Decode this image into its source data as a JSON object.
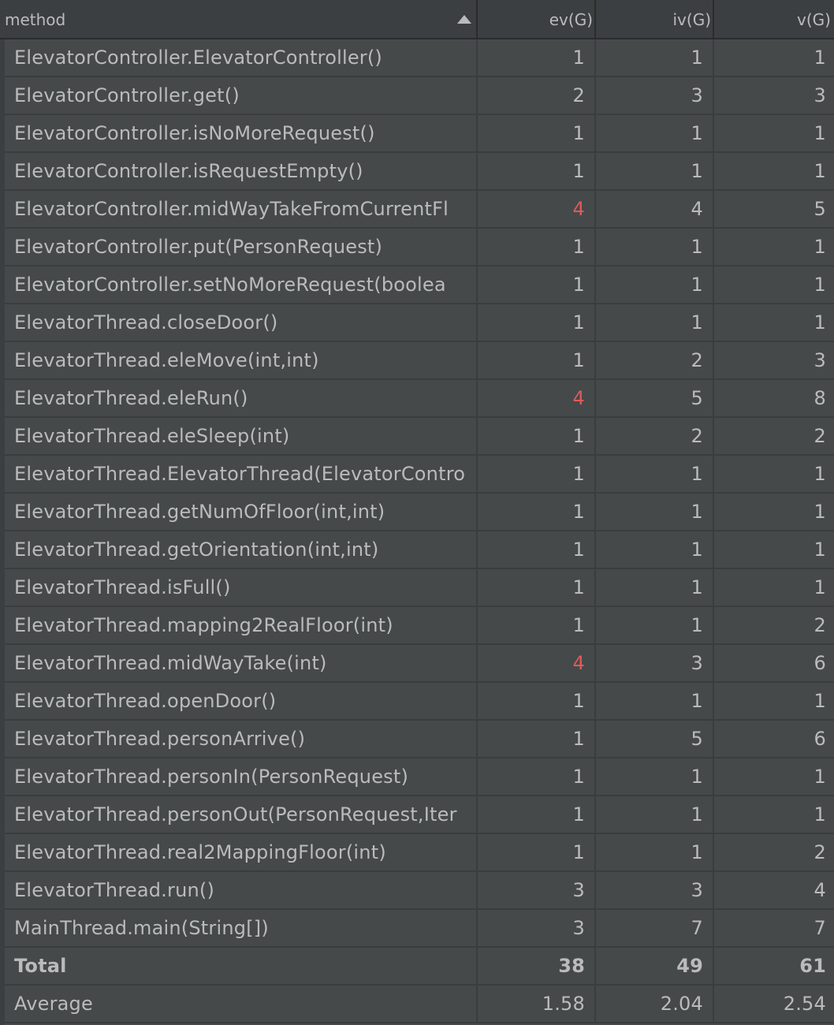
{
  "colors": {
    "background": "#3c3f41",
    "row_background": "#45494a",
    "text": "#bbbbbb",
    "highlight": "#e05a5a"
  },
  "header": {
    "method": "method",
    "ev": "ev(G)",
    "iv": "iv(G)",
    "v": "v(G)",
    "sort_icon": "sort-ascending-icon"
  },
  "rows": [
    {
      "method": "ElevatorController.ElevatorController()",
      "ev": "1",
      "iv": "1",
      "v": "1"
    },
    {
      "method": "ElevatorController.get()",
      "ev": "2",
      "iv": "3",
      "v": "3"
    },
    {
      "method": "ElevatorController.isNoMoreRequest()",
      "ev": "1",
      "iv": "1",
      "v": "1"
    },
    {
      "method": "ElevatorController.isRequestEmpty()",
      "ev": "1",
      "iv": "1",
      "v": "1"
    },
    {
      "method": "ElevatorController.midWayTakeFromCurrentFl",
      "ev": "4",
      "iv": "4",
      "v": "5",
      "ev_highlight": true
    },
    {
      "method": "ElevatorController.put(PersonRequest)",
      "ev": "1",
      "iv": "1",
      "v": "1"
    },
    {
      "method": "ElevatorController.setNoMoreRequest(boolea",
      "ev": "1",
      "iv": "1",
      "v": "1"
    },
    {
      "method": "ElevatorThread.closeDoor()",
      "ev": "1",
      "iv": "1",
      "v": "1"
    },
    {
      "method": "ElevatorThread.eleMove(int,int)",
      "ev": "1",
      "iv": "2",
      "v": "3"
    },
    {
      "method": "ElevatorThread.eleRun()",
      "ev": "4",
      "iv": "5",
      "v": "8",
      "ev_highlight": true
    },
    {
      "method": "ElevatorThread.eleSleep(int)",
      "ev": "1",
      "iv": "2",
      "v": "2"
    },
    {
      "method": "ElevatorThread.ElevatorThread(ElevatorContro",
      "ev": "1",
      "iv": "1",
      "v": "1"
    },
    {
      "method": "ElevatorThread.getNumOfFloor(int,int)",
      "ev": "1",
      "iv": "1",
      "v": "1"
    },
    {
      "method": "ElevatorThread.getOrientation(int,int)",
      "ev": "1",
      "iv": "1",
      "v": "1"
    },
    {
      "method": "ElevatorThread.isFull()",
      "ev": "1",
      "iv": "1",
      "v": "1"
    },
    {
      "method": "ElevatorThread.mapping2RealFloor(int)",
      "ev": "1",
      "iv": "1",
      "v": "2"
    },
    {
      "method": "ElevatorThread.midWayTake(int)",
      "ev": "4",
      "iv": "3",
      "v": "6",
      "ev_highlight": true
    },
    {
      "method": "ElevatorThread.openDoor()",
      "ev": "1",
      "iv": "1",
      "v": "1"
    },
    {
      "method": "ElevatorThread.personArrive()",
      "ev": "1",
      "iv": "5",
      "v": "6"
    },
    {
      "method": "ElevatorThread.personIn(PersonRequest)",
      "ev": "1",
      "iv": "1",
      "v": "1"
    },
    {
      "method": "ElevatorThread.personOut(PersonRequest,Iter",
      "ev": "1",
      "iv": "1",
      "v": "1"
    },
    {
      "method": "ElevatorThread.real2MappingFloor(int)",
      "ev": "1",
      "iv": "1",
      "v": "2"
    },
    {
      "method": "ElevatorThread.run()",
      "ev": "3",
      "iv": "3",
      "v": "4"
    },
    {
      "method": "MainThread.main(String[])",
      "ev": "3",
      "iv": "7",
      "v": "7"
    }
  ],
  "total": {
    "method": "Total",
    "ev": "38",
    "iv": "49",
    "v": "61"
  },
  "average": {
    "method": "Average",
    "ev": "1.58",
    "iv": "2.04",
    "v": "2.54"
  }
}
